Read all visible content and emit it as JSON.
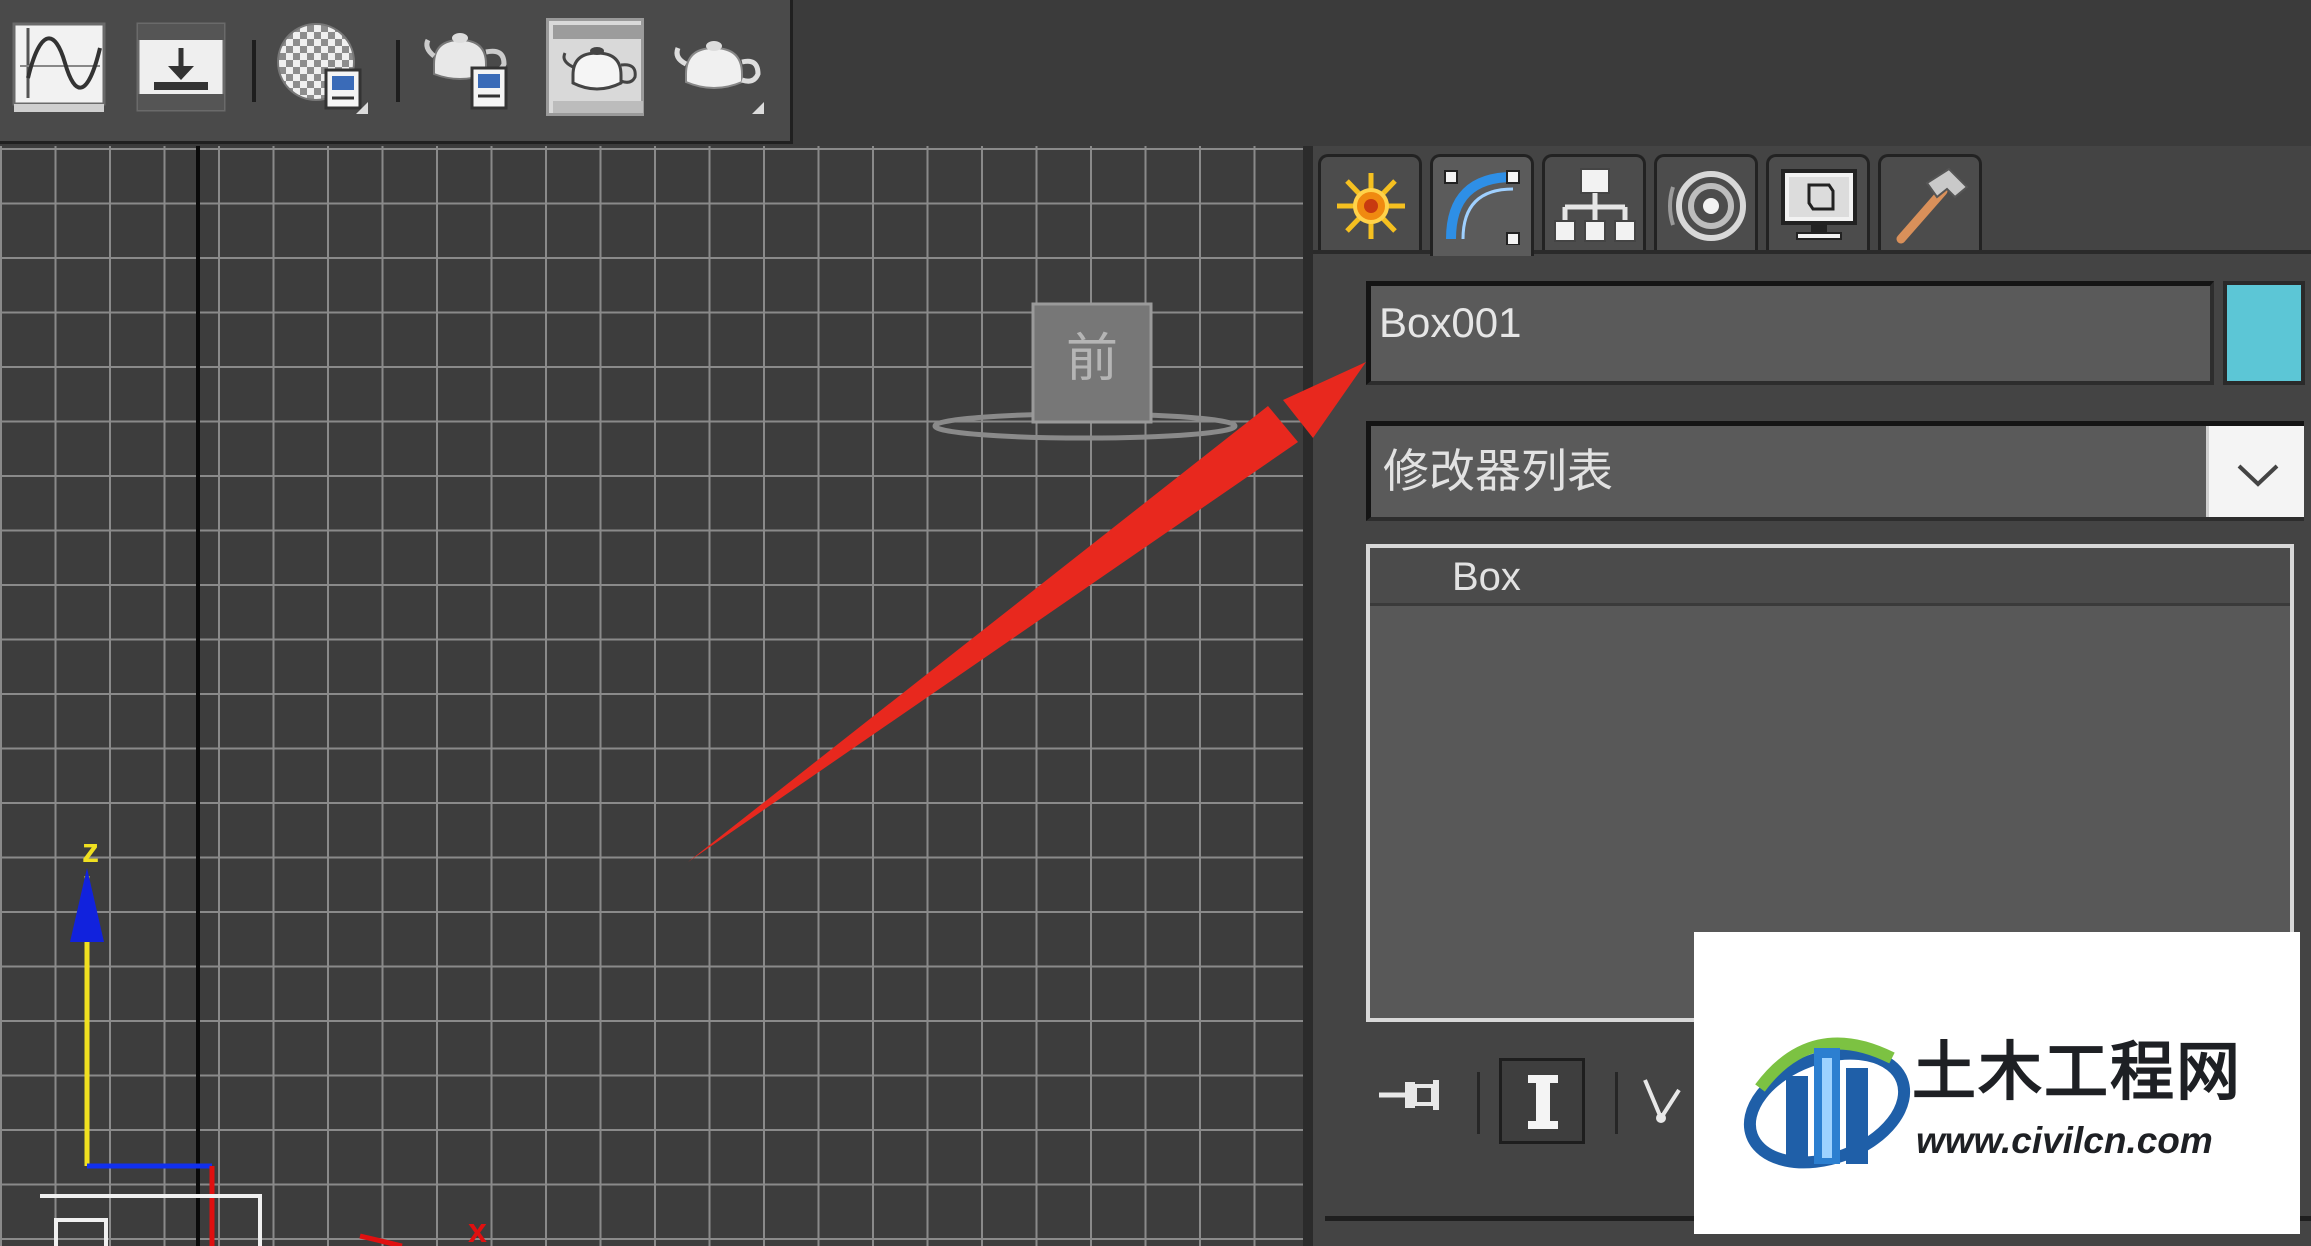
{
  "toolbar": {
    "buttons": [
      {
        "name": "curve-editor-icon"
      },
      {
        "name": "schematic-view-icon"
      },
      {
        "name": "material-editor-icon"
      },
      {
        "name": "render-setup-icon"
      },
      {
        "name": "rendered-frame-window-icon"
      },
      {
        "name": "render-production-icon"
      }
    ]
  },
  "viewport": {
    "axis_z_label": "z",
    "axis_x_label": "x",
    "viewcube_label": "前"
  },
  "command_panel": {
    "tabs": [
      {
        "name": "create-tab",
        "icon": "sun-burst-icon"
      },
      {
        "name": "modify-tab",
        "icon": "modify-curve-icon",
        "active": true
      },
      {
        "name": "hierarchy-tab",
        "icon": "hierarchy-icon"
      },
      {
        "name": "motion-tab",
        "icon": "motion-rings-icon"
      },
      {
        "name": "display-tab",
        "icon": "display-monitor-icon"
      },
      {
        "name": "utilities-tab",
        "icon": "hammer-icon"
      }
    ],
    "object_name": "Box001",
    "object_color": "#5cc6d6",
    "modifier_list_label": "修改器列表",
    "stack_items": [
      "Box"
    ]
  },
  "annotation": {
    "arrow_color": "#e8281e"
  },
  "watermark": {
    "brand": "土木工程网",
    "url": "www.civilcn.com"
  }
}
